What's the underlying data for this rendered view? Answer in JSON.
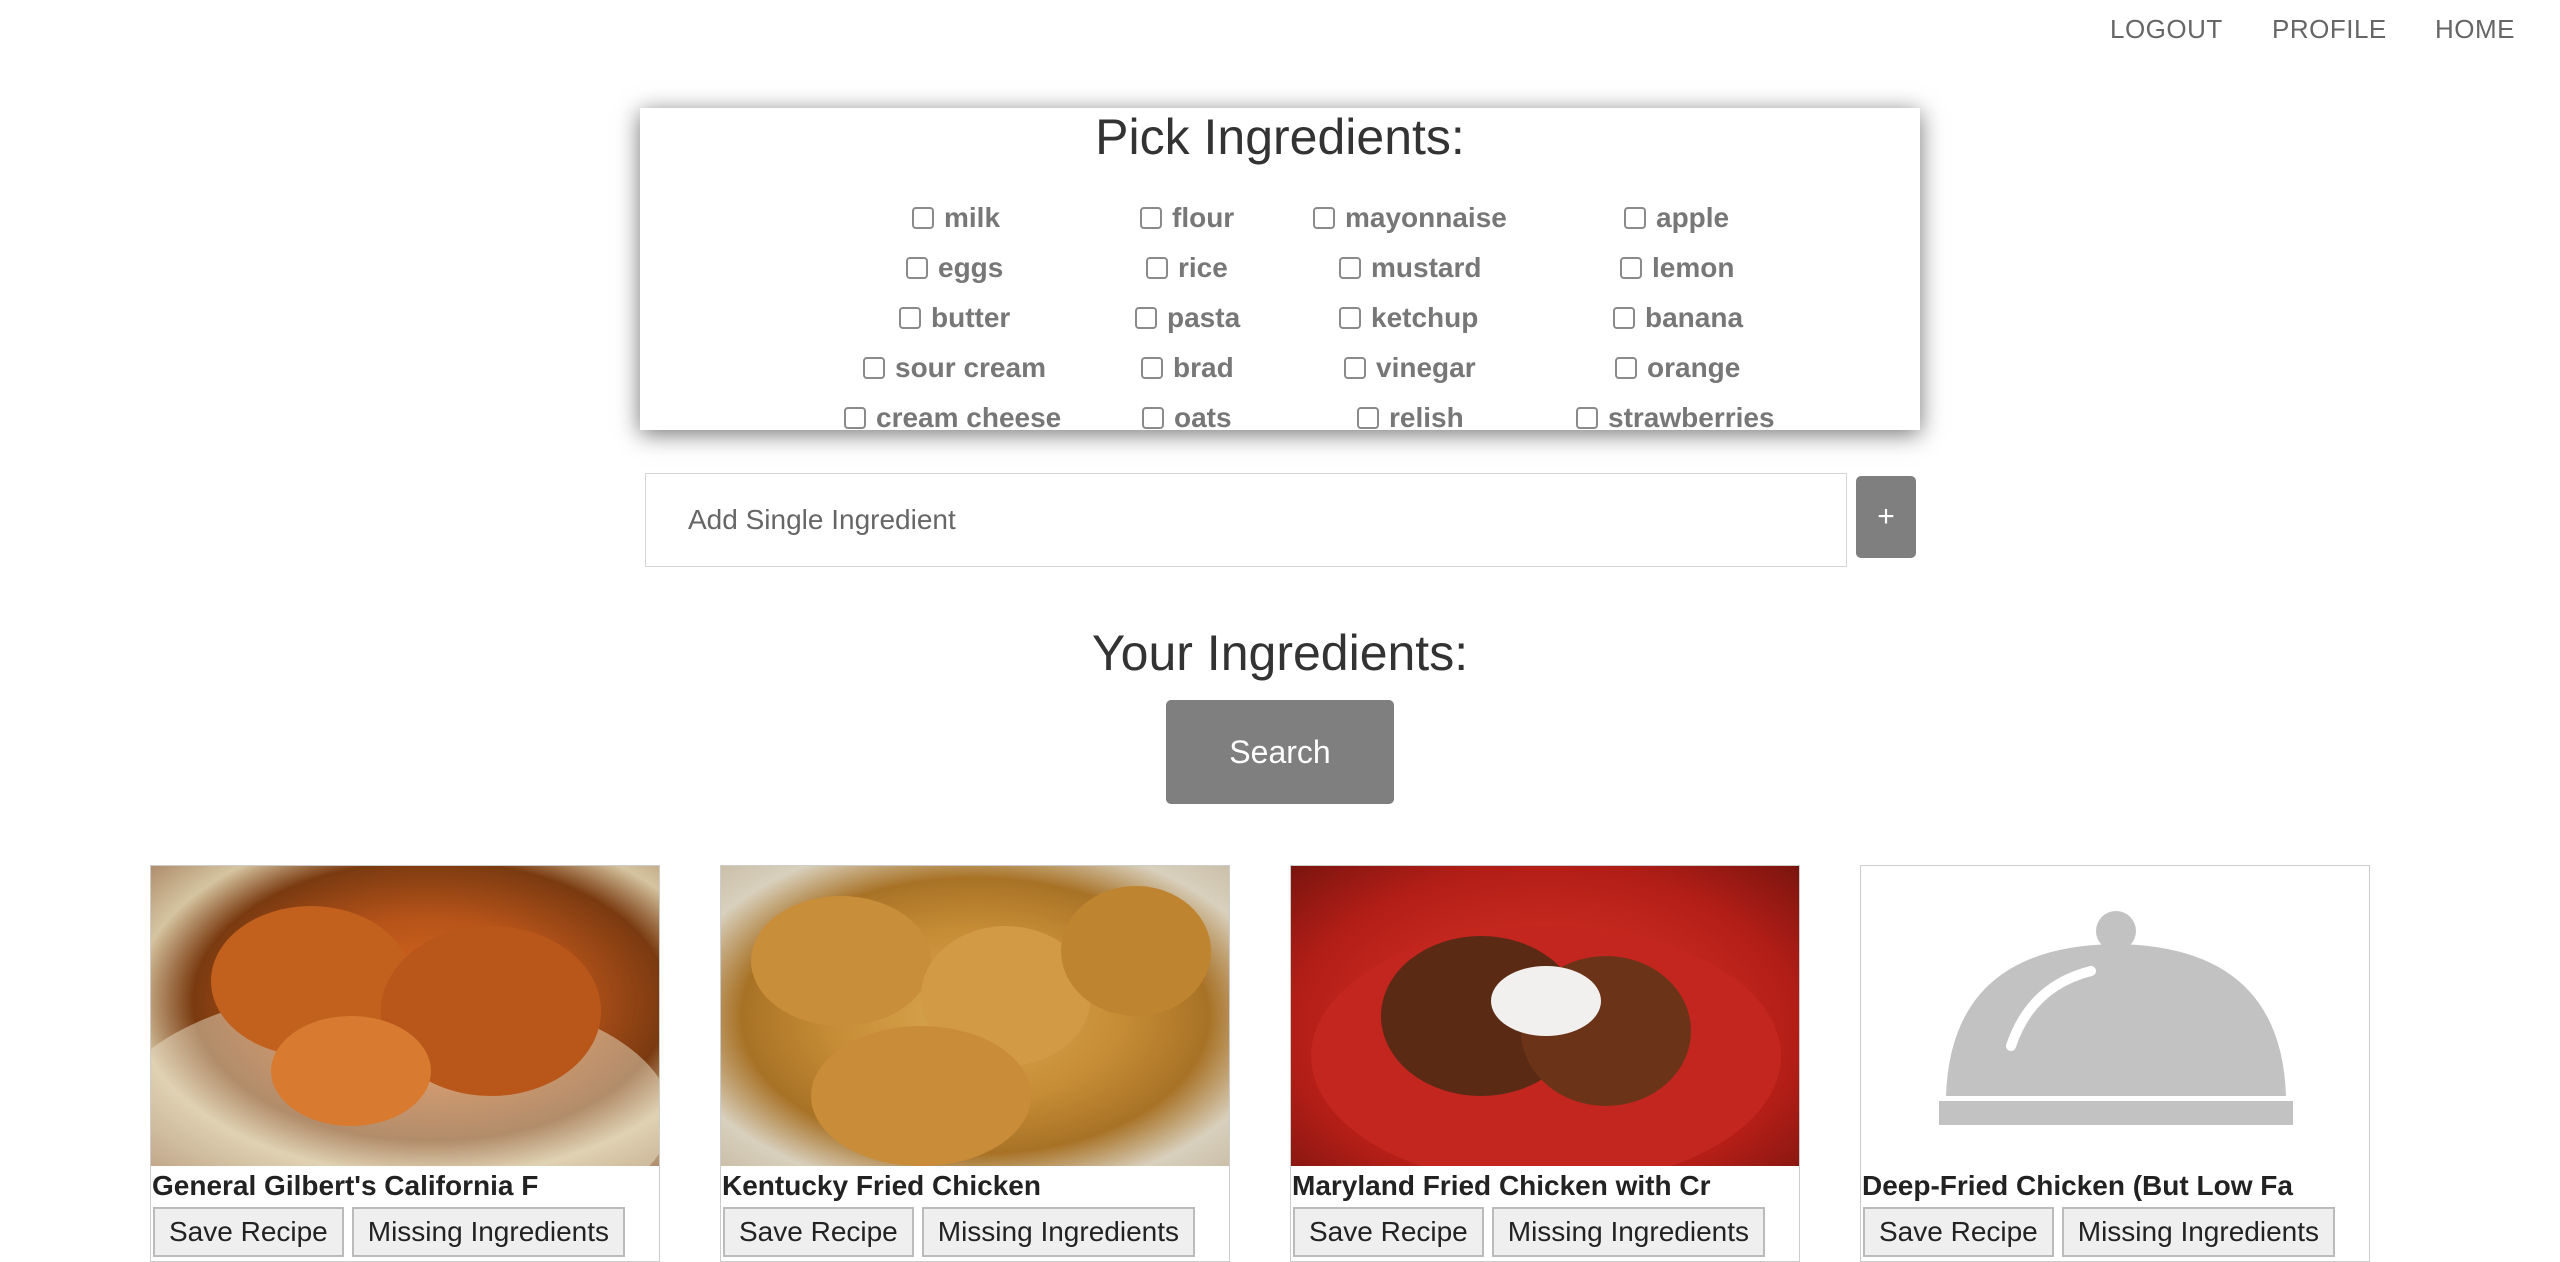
{
  "nav": {
    "logout": "LOGOUT",
    "profile": "PROFILE",
    "home": "HOME"
  },
  "pick": {
    "title": "Pick Ingredients:",
    "columns": [
      [
        "milk",
        "eggs",
        "butter",
        "sour cream",
        "cream cheese"
      ],
      [
        "flour",
        "rice",
        "pasta",
        "brad",
        "oats"
      ],
      [
        "mayonnaise",
        "mustard",
        "ketchup",
        "vinegar",
        "relish"
      ],
      [
        "apple",
        "lemon",
        "banana",
        "orange",
        "strawberries"
      ]
    ]
  },
  "add": {
    "placeholder": "Add Single Ingredient",
    "button": "+"
  },
  "your": {
    "title": "Your Ingredients:",
    "search": "Search"
  },
  "recipes": [
    {
      "title": "General Gilbert's California F",
      "save": "Save Recipe",
      "missing": "Missing Ingredients"
    },
    {
      "title": "Kentucky Fried Chicken",
      "save": "Save Recipe",
      "missing": "Missing Ingredients"
    },
    {
      "title": "Maryland Fried Chicken with Cr",
      "save": "Save Recipe",
      "missing": "Missing Ingredients"
    },
    {
      "title": "Deep-Fried Chicken (But Low Fa",
      "save": "Save Recipe",
      "missing": "Missing Ingredients"
    }
  ]
}
